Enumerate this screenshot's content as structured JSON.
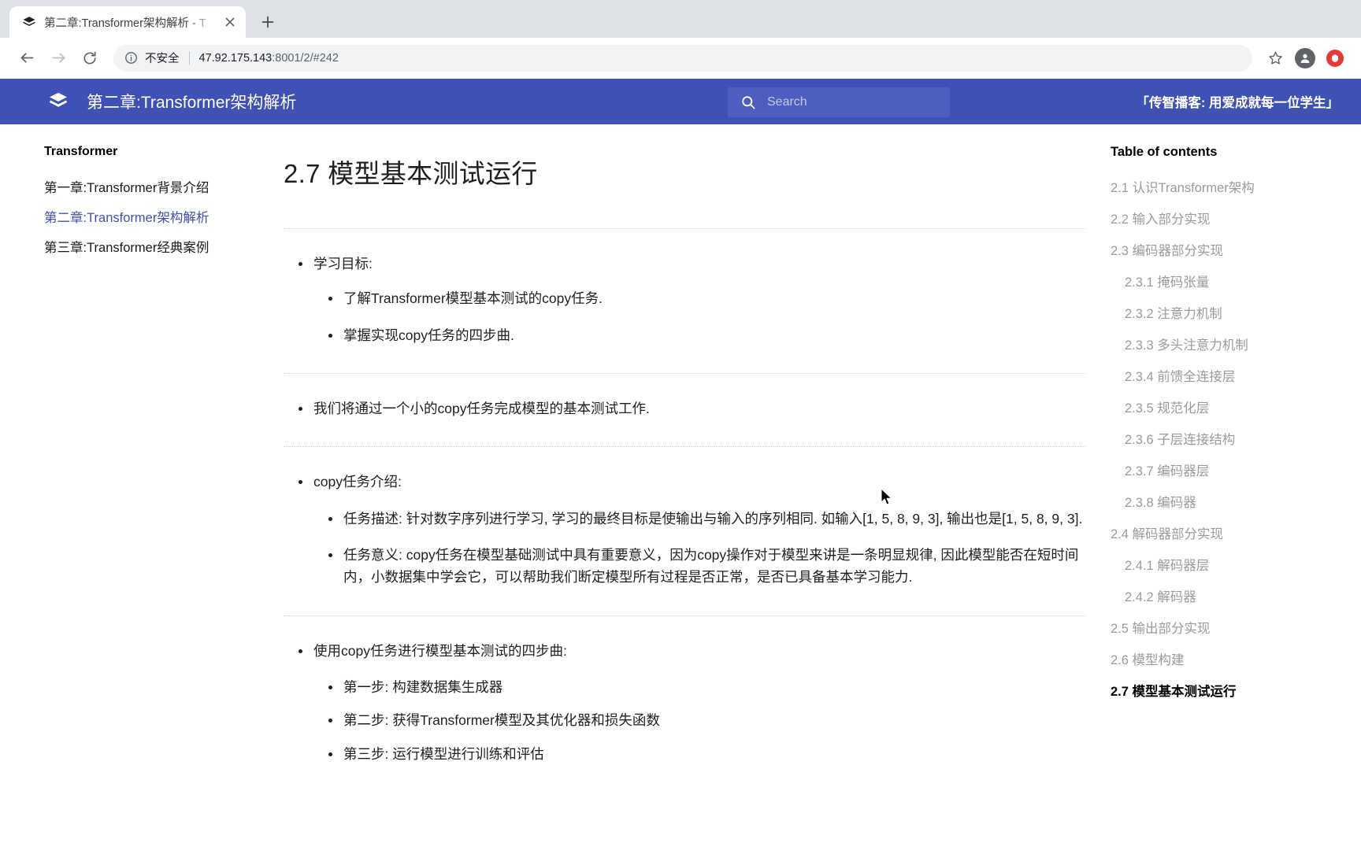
{
  "browser": {
    "tab": {
      "title": "第二章:Transformer架构解析 - T",
      "favicon_icon": "book-stack-icon",
      "close_icon": "close-icon"
    },
    "new_tab_label": "+",
    "nav": {
      "back_icon": "arrow-back-icon",
      "forward_icon": "arrow-forward-icon",
      "reload_icon": "reload-icon"
    },
    "omnibox": {
      "info_icon": "info-circle-icon",
      "security_label": "不安全",
      "url_host": "47.92.175.143",
      "url_path": ":8001/2/#242"
    },
    "bookmark_icon": "star-icon",
    "profile_icon": "account-icon",
    "extension_icon": "extension-badge-icon"
  },
  "site": {
    "logo_icon": "book-stack-icon",
    "title": "第二章:Transformer架构解析",
    "search": {
      "icon": "search-icon",
      "placeholder": "Search",
      "value": ""
    },
    "slogan": "「传智播客: 用爱成就每一位学生」",
    "accent_color": "#3f51b5"
  },
  "sidebar": {
    "brand": "Transformer",
    "items": [
      {
        "label": "第一章:Transformer背景介绍",
        "active": false
      },
      {
        "label": "第二章:Transformer架构解析",
        "active": true
      },
      {
        "label": "第三章:Transformer经典案例",
        "active": false
      }
    ]
  },
  "main": {
    "heading": "2.7 模型基本测试运行",
    "block1": {
      "title": "学习目标:",
      "items": [
        "了解Transformer模型基本测试的copy任务.",
        "掌握实现copy任务的四步曲."
      ]
    },
    "block2": {
      "title": "我们将通过一个小的copy任务完成模型的基本测试工作."
    },
    "block3": {
      "title": "copy任务介绍:",
      "items": [
        "任务描述: 针对数字序列进行学习, 学习的最终目标是使输出与输入的序列相同. 如输入[1, 5, 8, 9, 3], 输出也是[1, 5, 8, 9, 3].",
        "任务意义: copy任务在模型基础测试中具有重要意义，因为copy操作对于模型来讲是一条明显规律, 因此模型能否在短时间内，小数据集中学会它，可以帮助我们断定模型所有过程是否正常，是否已具备基本学习能力."
      ]
    },
    "block4": {
      "title": "使用copy任务进行模型基本测试的四步曲:",
      "items": [
        "第一步: 构建数据集生成器",
        "第二步: 获得Transformer模型及其优化器和损失函数",
        "第三步: 运行模型进行训练和评估"
      ]
    }
  },
  "toc": {
    "title": "Table of contents",
    "items": [
      {
        "label": "2.1 认识Transformer架构",
        "level": 2,
        "active": false
      },
      {
        "label": "2.2 输入部分实现",
        "level": 2,
        "active": false
      },
      {
        "label": "2.3 编码器部分实现",
        "level": 2,
        "active": false
      },
      {
        "label": "2.3.1 掩码张量",
        "level": 3,
        "active": false
      },
      {
        "label": "2.3.2 注意力机制",
        "level": 3,
        "active": false
      },
      {
        "label": "2.3.3 多头注意力机制",
        "level": 3,
        "active": false
      },
      {
        "label": "2.3.4 前馈全连接层",
        "level": 3,
        "active": false
      },
      {
        "label": "2.3.5 规范化层",
        "level": 3,
        "active": false
      },
      {
        "label": "2.3.6 子层连接结构",
        "level": 3,
        "active": false
      },
      {
        "label": "2.3.7 编码器层",
        "level": 3,
        "active": false
      },
      {
        "label": "2.3.8 编码器",
        "level": 3,
        "active": false
      },
      {
        "label": "2.4 解码器部分实现",
        "level": 2,
        "active": false
      },
      {
        "label": "2.4.1 解码器层",
        "level": 3,
        "active": false
      },
      {
        "label": "2.4.2 解码器",
        "level": 3,
        "active": false
      },
      {
        "label": "2.5 输出部分实现",
        "level": 2,
        "active": false
      },
      {
        "label": "2.6 模型构建",
        "level": 2,
        "active": false
      },
      {
        "label": "2.7 模型基本测试运行",
        "level": 2,
        "active": true
      }
    ]
  }
}
